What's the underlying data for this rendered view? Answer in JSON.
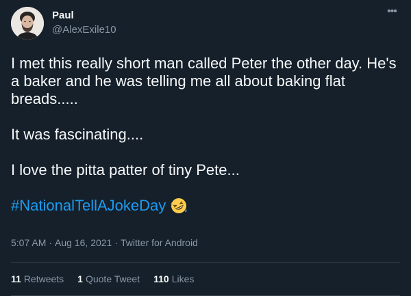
{
  "author": {
    "display_name": "Paul",
    "handle": "@AlexExile10"
  },
  "tweet": {
    "paragraphs": [
      "I met this really short man called Peter the other day. He's a baker and he was telling me all about baking flat breads.....",
      "It was fascinating....",
      "I love the pitta patter of tiny Pete..."
    ],
    "hashtag": "#NationalTellAJokeDay",
    "emoji": "rolling-on-floor-laughing-emoji"
  },
  "meta": {
    "time": "5:07 AM",
    "separator": "·",
    "date": "Aug 16, 2021",
    "source": "Twitter for Android"
  },
  "stats": {
    "retweets_count": "11",
    "retweets_label": "Retweets",
    "quotes_count": "1",
    "quotes_label": "Quote Tweet",
    "likes_count": "110",
    "likes_label": "Likes"
  },
  "colors": {
    "background": "#15202b",
    "text": "#f7f9f9",
    "secondary": "#8b98a5",
    "accent": "#1d9bf0",
    "divider": "#38444d"
  }
}
